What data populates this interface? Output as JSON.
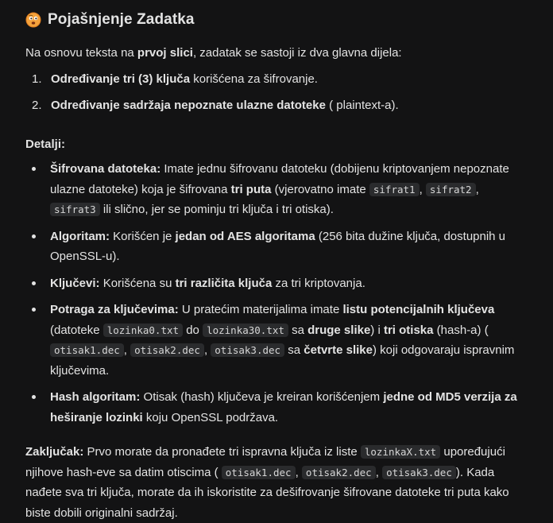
{
  "heading": {
    "title": "Pojašnjenje Zadatka",
    "icon": "thinking-face-emoji"
  },
  "intro": {
    "before": "Na osnovu teksta na ",
    "bold": "prvoj slici",
    "after": ", zadatak se sastoji iz dva glavna dijela:"
  },
  "steps": [
    {
      "num": "1.",
      "bold": "Određivanje tri (3) ključa",
      "rest": " korišćena za šifrovanje."
    },
    {
      "num": "2.",
      "bold": "Određivanje sadržaja nepoznate ulazne datoteke",
      "rest": " ( plaintext-a)."
    }
  ],
  "details_label": "Detalji:",
  "details": {
    "encrypted": {
      "label": "Šifrovana datoteka:",
      "t1": " Imate jednu šifrovanu datoteku (dobijenu kriptovanjem nepoznate ulazne datoteke) koja je šifrovana ",
      "b1": "tri puta",
      "t2": " (vjerovatno imate ",
      "c1": "sifrat1",
      "sep1": ", ",
      "c2": "sifrat2",
      "sep2": ", ",
      "c3": "sifrat3",
      "t3": " ili slično, jer se pominju tri ključa i tri otiska)."
    },
    "algorithm": {
      "label": "Algoritam:",
      "t1": " Korišćen je ",
      "b1": "jedan od AES algoritama",
      "t2": " (256 bita dužine ključa, dostupnih u OpenSSL-u)."
    },
    "keys": {
      "label": "Ključevi:",
      "t1": " Korišćena su ",
      "b1": "tri različita ključa",
      "t2": " za tri kriptovanja."
    },
    "search": {
      "label": "Potraga za ključevima:",
      "t1": " U pratećim materijalima imate ",
      "b1": "listu potencijalnih ključeva",
      "t2": " (datoteke ",
      "c1": "lozinka0.txt",
      "t3": " do ",
      "c2": "lozinka30.txt",
      "t4": " sa ",
      "b2": "druge slike",
      "t5": ") i ",
      "b3": "tri otiska",
      "t6": " (hash-a) ( ",
      "c3": "otisak1.dec",
      "sep1": ", ",
      "c4": "otisak2.dec",
      "sep2": ", ",
      "c5": "otisak3.dec",
      "t7": " sa ",
      "b4": "četvrte slike",
      "t8": ") koji odgovaraju ispravnim ključevima."
    },
    "hash": {
      "label": "Hash algoritam:",
      "t1": " Otisak (hash) ključeva je kreiran korišćenjem ",
      "b1": "jedne od MD5 verzija za heširanje lozinki",
      "t2": " koju OpenSSL podržava."
    }
  },
  "conclusion": {
    "label": "Zaključak:",
    "t1": " Prvo morate da pronađete tri ispravna ključa iz liste ",
    "c1": "lozinkaX.txt",
    "t2": " upoređujući njihove hash-eve sa datim otiscima ( ",
    "c2": "otisak1.dec",
    "sep1": ", ",
    "c3": "otisak2.dec",
    "sep2": ", ",
    "c4": "otisak3.dec",
    "t3": "). Kada nađete sva tri ključa, morate da ih iskoristite za dešifrovanje šifrovane datoteke tri puta kako biste dobili originalni sadržaj."
  },
  "colors": {
    "background": "#131314",
    "text": "#e3e3e3",
    "code_bg": "#2a2b2d"
  }
}
